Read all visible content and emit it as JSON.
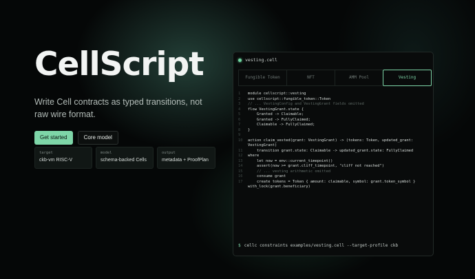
{
  "hero": {
    "title": "CellScript",
    "tagline": "Write Cell contracts as typed transitions, not raw wire format.",
    "primary_button": "Get started",
    "secondary_button": "Core model"
  },
  "stats": [
    {
      "key": "target",
      "value": "ckb-vm RISC-V"
    },
    {
      "key": "model",
      "value": "schema-backed Cells"
    },
    {
      "key": "output",
      "value": "metadata + ProofPlan"
    }
  ],
  "editor": {
    "filename": "vesting.cell",
    "tabs": [
      "Fungible Token",
      "NFT",
      "AMM Pool",
      "Vesting"
    ],
    "active_tab": "Vesting",
    "lines": [
      {
        "n": "1",
        "text": "module cellscript::vesting",
        "comment": false
      },
      {
        "n": "2",
        "text": "use cellscript::fungible_token::Token",
        "comment": false
      },
      {
        "n": "3",
        "text": "// ... VestingConfig and VestingGrant fields omitted",
        "comment": true
      },
      {
        "n": "4",
        "text": "flow VestingGrant.state {",
        "comment": false
      },
      {
        "n": "5",
        "text": "    Granted -> Claimable;",
        "comment": false
      },
      {
        "n": "6",
        "text": "    Granted -> FullyClaimed;",
        "comment": false
      },
      {
        "n": "7",
        "text": "    Claimable -> FullyClaimed;",
        "comment": false
      },
      {
        "n": "8",
        "text": "}",
        "comment": false
      },
      {
        "n": "9",
        "text": "",
        "comment": false
      },
      {
        "n": "10",
        "text": "action claim_vested(grant: VestingGrant) -> (tokens: Token, updated_grant: VestingGrant)",
        "comment": false
      },
      {
        "n": "11",
        "text": "    transition grant.state: Claimable -> updated_grant.state: FullyClaimed",
        "comment": false
      },
      {
        "n": "12",
        "text": "where",
        "comment": false
      },
      {
        "n": "13",
        "text": "    let now = env::current_timepoint()",
        "comment": false
      },
      {
        "n": "14",
        "text": "    assert(now >= grant.cliff_timepoint, \"cliff not reached\")",
        "comment": false
      },
      {
        "n": "15",
        "text": "    // ... vesting arithmetic omitted",
        "comment": true
      },
      {
        "n": "16",
        "text": "    consume grant",
        "comment": false
      },
      {
        "n": "17",
        "text": "    create tokens = Token { amount: claimable, symbol: grant.token_symbol } with_lock(grant.beneficiary)",
        "comment": false
      }
    ],
    "prompt_symbol": "$",
    "command": "cellc constraints examples/vesting.cell --target-profile ckb"
  }
}
